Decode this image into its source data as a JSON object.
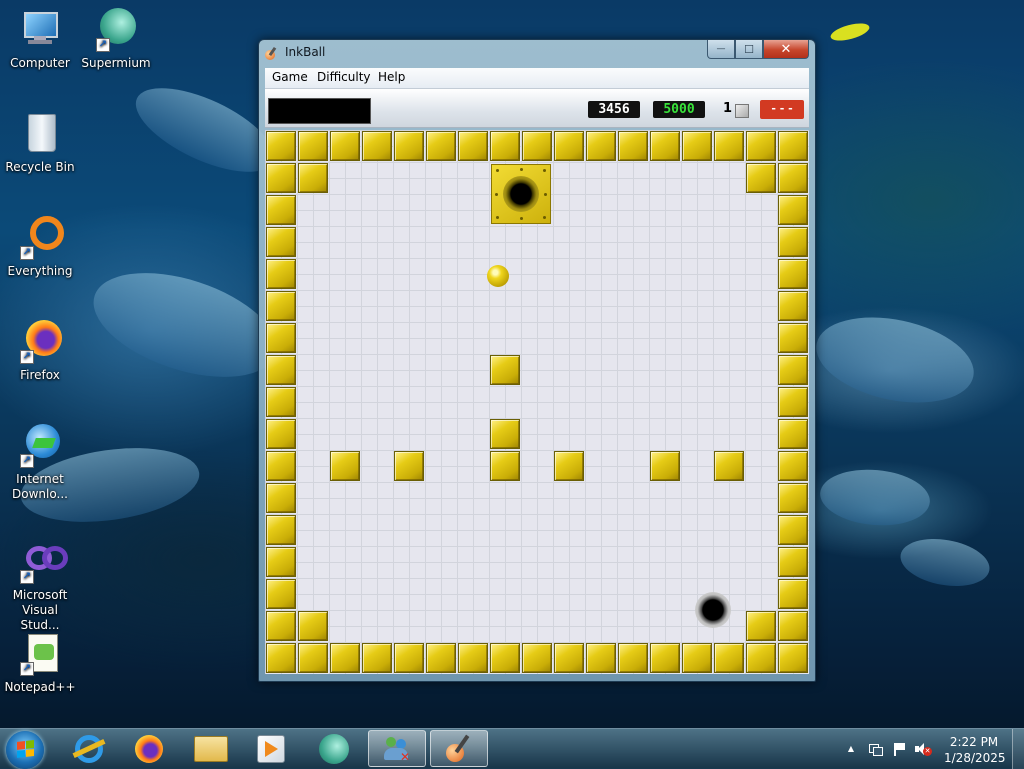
{
  "desktop": {
    "icons": [
      {
        "label": "Computer"
      },
      {
        "label": "Supermium"
      },
      {
        "label": "Recycle Bin"
      },
      {
        "label": "Everything"
      },
      {
        "label": "Firefox"
      },
      {
        "label": "Internet Downlo..."
      },
      {
        "label": "Microsoft Visual Stud..."
      },
      {
        "label": "Notepad++"
      }
    ]
  },
  "window": {
    "title": "InkBall",
    "menu": [
      "Game",
      "Difficulty",
      "Help"
    ],
    "minimize_glyph": "—",
    "maximize_glyph": "☐",
    "close_glyph": "✕"
  },
  "toolbar": {
    "score": "3456",
    "target_score": "5000",
    "ink_color_count": "1",
    "timer": "- - -"
  },
  "board": {
    "grid_cols": 17,
    "grid_rows": 17,
    "ball_color": "gold",
    "goal_colors": [
      "gold",
      "gray"
    ]
  },
  "taskbar": {
    "pinned": [
      "start-button",
      "internet-explorer",
      "firefox",
      "file-explorer",
      "media-player",
      "supermium",
      "network-app",
      "inkball"
    ],
    "clock_time": "2:22 PM",
    "clock_date": "1/28/2025",
    "tray_arrow": "▲"
  },
  "colors": {
    "block_gold": "#e6cc16",
    "timer_red": "#d23a22",
    "target_green": "#38e23a",
    "board_bg": "#e6e6ee"
  }
}
